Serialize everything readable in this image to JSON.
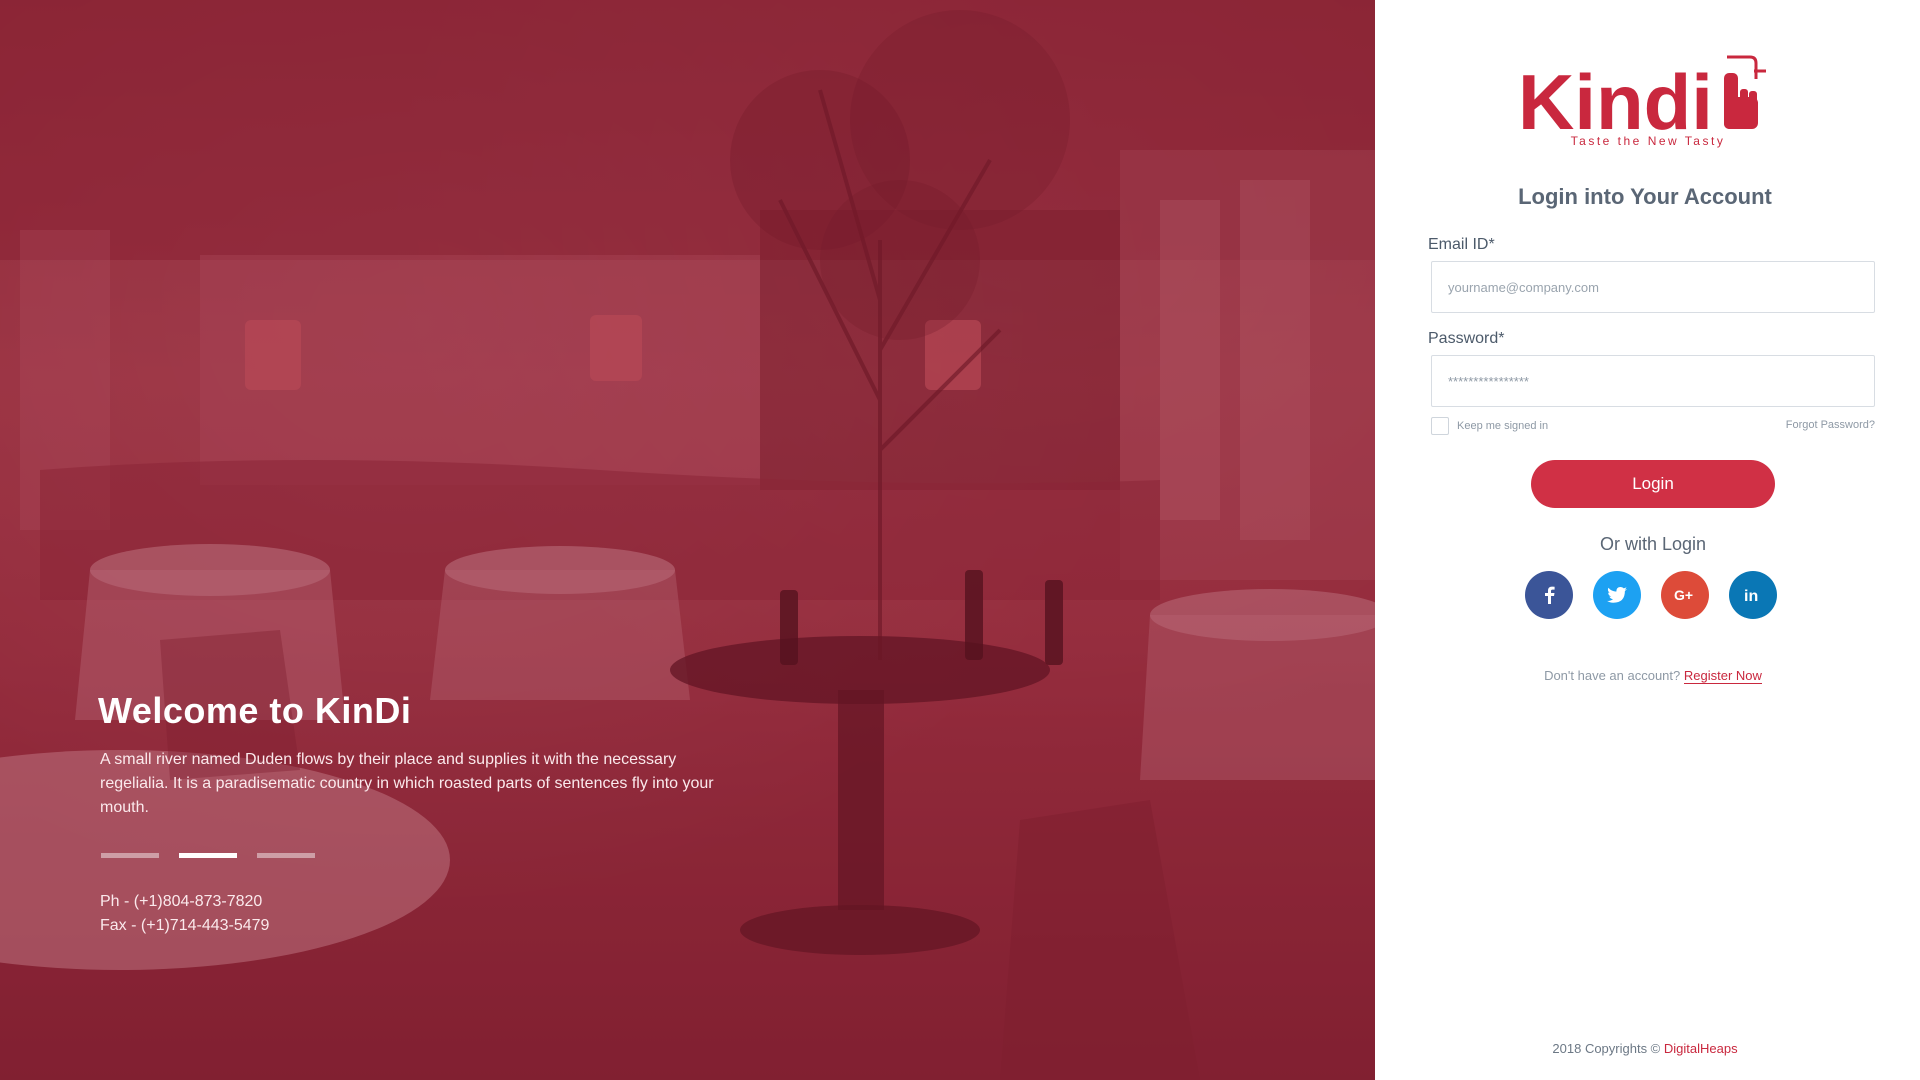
{
  "hero": {
    "title": "Welcome to KinDi",
    "text": "A small river named Duden flows by their place and supplies it with the necessary regelialia. It is a paradisematic country in which roasted parts of sentences fly into your mouth.",
    "phone": "Ph - (+1)804-873-7820",
    "fax": "Fax - (+1)714-443-5479",
    "slides": 3,
    "active_slide": 2
  },
  "brand": {
    "name": "Kindi",
    "tagline": "Taste the New Tasty",
    "color": "#c9283e"
  },
  "login": {
    "title": "Login into Your Account",
    "email_label": "Email ID*",
    "email_placeholder": "yourname@company.com",
    "password_label": "Password*",
    "password_value": "****************",
    "remember_label": "Keep me signed in",
    "forgot_label": "Forgot Password?",
    "button_label": "Login",
    "social_heading": "Or with Login",
    "socials": [
      {
        "name": "facebook",
        "icon": "facebook-icon",
        "color": "#3b5598"
      },
      {
        "name": "twitter",
        "icon": "twitter-icon",
        "color": "#1da1f2"
      },
      {
        "name": "google-plus",
        "icon": "google-plus-icon",
        "color": "#dd4b39"
      },
      {
        "name": "linkedin",
        "icon": "linkedin-icon",
        "color": "#0a77b5"
      }
    ],
    "register_prompt": "Don't have an account?",
    "register_link": "Register Now"
  },
  "footer": {
    "copyright": "2018 Copyrights ©",
    "company": "DigitalHeaps"
  }
}
